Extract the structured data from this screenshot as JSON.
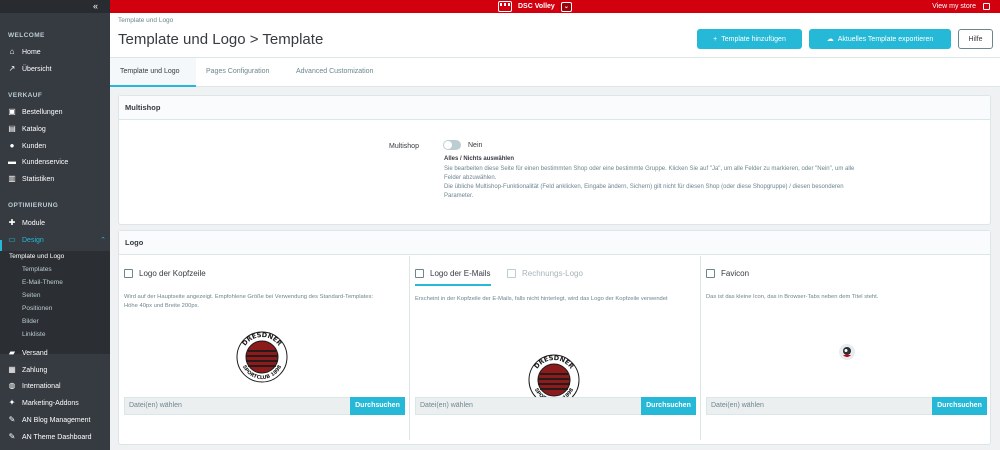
{
  "topbar": {
    "collapse_icon": "«",
    "shop_name": "DSC Volley",
    "shop_caret": "⌄",
    "view_store": "View my store"
  },
  "sidebar": {
    "sections": [
      "WELCOME",
      "VERKAUF",
      "OPTIMIERUNG"
    ],
    "items": [
      {
        "label": "Home",
        "icon": "home-icon"
      },
      {
        "label": "Übersicht",
        "icon": "trend-icon"
      },
      {
        "label": "Bestellungen",
        "icon": "cart-icon"
      },
      {
        "label": "Katalog",
        "icon": "store-icon"
      },
      {
        "label": "Kunden",
        "icon": "user-icon"
      },
      {
        "label": "Kundenservice",
        "icon": "chat-icon"
      },
      {
        "label": "Statistiken",
        "icon": "chart-icon"
      },
      {
        "label": "Module",
        "icon": "puzzle-icon"
      },
      {
        "label": "Design",
        "icon": "monitor-icon"
      },
      {
        "label": "Versand",
        "icon": "truck-icon"
      },
      {
        "label": "Zahlung",
        "icon": "card-icon"
      },
      {
        "label": "International",
        "icon": "globe-icon"
      },
      {
        "label": "Marketing-Addons",
        "icon": "rocket-icon"
      },
      {
        "label": "AN Blog Management",
        "icon": "blog-icon"
      },
      {
        "label": "AN Theme Dashboard",
        "icon": "theme-icon"
      }
    ],
    "design_sub": [
      "Template und Logo",
      "Templates",
      "E-Mail-Theme",
      "Seiten",
      "Positionen",
      "Bilder",
      "Linkliste"
    ]
  },
  "header": {
    "breadcrumb": "Template und Logo",
    "title": "Template und Logo > Template",
    "btn_add": "Template hinzufügen",
    "btn_export": "Aktuelles Template exportieren",
    "btn_help": "Hilfe"
  },
  "tabs": [
    "Template und Logo",
    "Pages Configuration",
    "Advanced Customization"
  ],
  "multishop": {
    "panel_title": "Multishop",
    "label": "Multishop",
    "value": "Nein",
    "help_title": "Alles / Nichts auswählen",
    "help_lines": [
      "Sie bearbeiten diese Seite für einen bestimmten Shop oder eine bestimmte Gruppe. Klicken Sie auf \"Ja\", um alle Felder zu markieren, oder \"Nein\", um alle",
      "Felder abzuwählen.",
      "Die übliche Multishop-Funktionalität (Feld anklicken, Eingabe ändern, Sichern) gilt nicht für diesen Shop (oder diese Shopgruppe) / diesen besonderen",
      "Parameter."
    ]
  },
  "logo": {
    "panel_title": "Logo",
    "header_logo": {
      "title": "Logo der Kopfzeile",
      "desc_lines": [
        "Wird auf der Hauptseite angezeigt. Empfohlene Größe bei Verwendung des Standard-Templates:",
        "Höhe 40px und Breite 200px."
      ],
      "file_placeholder": "Datei(en) wählen",
      "browse": "Durchsuchen"
    },
    "email_logo": {
      "title": "Logo der E-Mails",
      "alt_title": "Rechnungs-Logo",
      "desc": "Erscheint in der Kopfzeile der E-Mails, falls nicht hinterlegt, wird das Logo der Kopfzeile verwendet",
      "file_placeholder": "Datei(en) wählen",
      "browse": "Durchsuchen"
    },
    "favicon": {
      "title": "Favicon",
      "desc": "Das ist das kleine Icon, das in Browser-Tabs neben dem Titel steht.",
      "file_placeholder": "Datei(en) wählen",
      "browse": "Durchsuchen"
    },
    "emblem_top": "DRESDNER",
    "emblem_bottom": "SPORTCLUB 1898"
  },
  "colors": {
    "accent": "#25b9d7",
    "topbar": "#d2000e",
    "sidebar": "#363a41"
  }
}
